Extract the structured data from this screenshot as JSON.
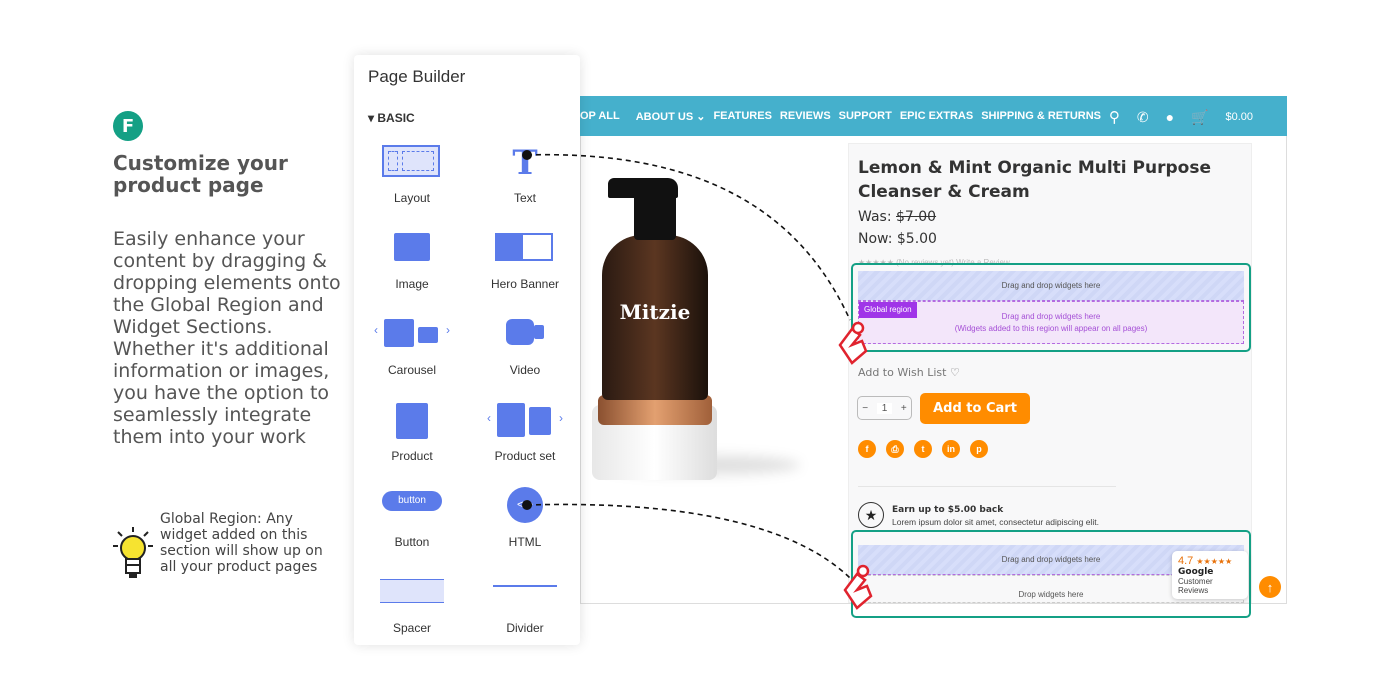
{
  "intro": {
    "logo_letter": "F",
    "title": "Customize your product page",
    "description": "Easily enhance your content by dragging & dropping elements onto the Global Region and Widget Sections. Whether it's additional information or images, you have the option to seamlessly integrate them into your work",
    "note": "Global Region: Any widget added on this section will show up on all your product pages"
  },
  "nav": {
    "items": [
      "OP ALL",
      "ABOUT US ⌄",
      "FEATURES",
      "REVIEWS",
      "SUPPORT",
      "EPIC EXTRAS",
      "SHIPPING & RETURNS"
    ],
    "cart_total": "$0.00"
  },
  "builder": {
    "title": "Page Builder",
    "section": "BASIC",
    "widgets": [
      "Layout",
      "Text",
      "Image",
      "Hero Banner",
      "Carousel",
      "Video",
      "Product",
      "Product set",
      "Button",
      "HTML",
      "Spacer",
      "Divider"
    ],
    "button_text": "button"
  },
  "product": {
    "name": "Lemon & Mint Organic Multi Purpose Cleanser & Cream",
    "was_label": "Was:",
    "was_price": "$7.00",
    "now": "Now: $5.00",
    "reviews": "(No reviews yet)",
    "write_review": "Write a Review",
    "wishlist": "Add to Wish List",
    "qty": "1",
    "add_to_cart": "Add to Cart",
    "brand_on_bottle": "Mitzie",
    "earn_title": "Earn up to $5.00 back",
    "earn_text": "Lorem ipsum dolor sit amet, consectetur adipiscing elit."
  },
  "zones": {
    "drag": "Drag and drop widgets here",
    "global_tag": "Global region",
    "global_text1": "Drag and drop widgets here",
    "global_text2": "(Widgets added to this region will appear on all pages)",
    "drop": "Drop widgets here"
  },
  "google": {
    "rating": "4.7",
    "stars": "★★★★★",
    "brand": "Google",
    "label": "Customer Reviews"
  },
  "colors": {
    "accent": "#14a085",
    "nav": "#45b0cc",
    "orange": "#ff8c00",
    "widget": "#5b7bea",
    "global": "#a54fd6"
  }
}
